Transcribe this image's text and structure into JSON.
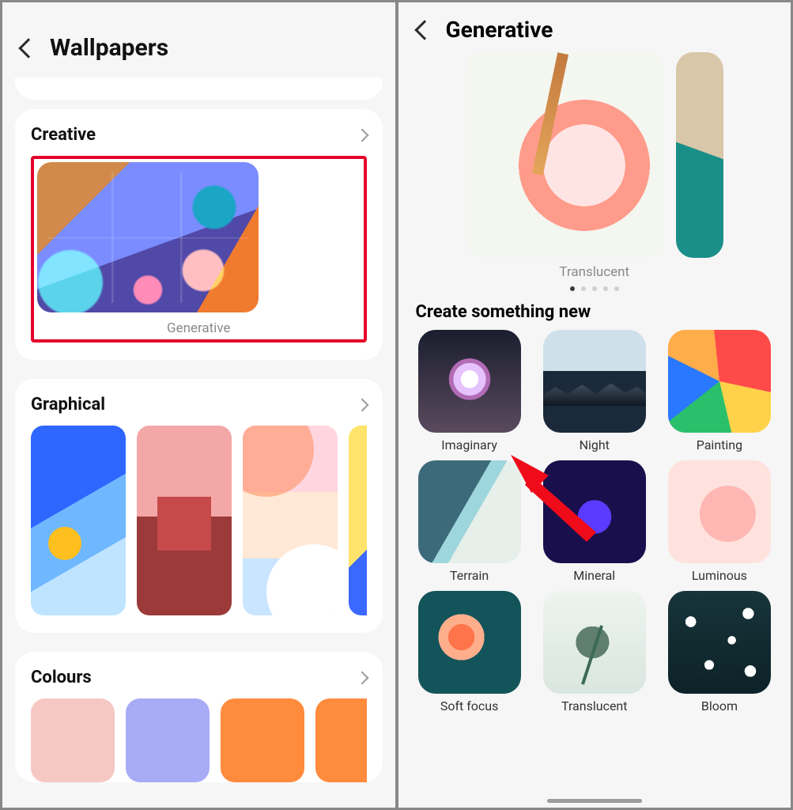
{
  "left": {
    "title": "Wallpapers",
    "creative": {
      "heading": "Creative",
      "generative_label": "Generative"
    },
    "graphical": {
      "heading": "Graphical"
    },
    "colours": {
      "heading": "Colours",
      "swatches": [
        "#f6c8c4",
        "#a8abf6",
        "#ff8b3d",
        "#ff8b3d"
      ]
    }
  },
  "right": {
    "title": "Generative",
    "hero_label": "Translucent",
    "page_dots": {
      "count": 5,
      "active": 0
    },
    "create_heading": "Create something new",
    "categories": [
      {
        "id": "imaginary",
        "label": "Imaginary"
      },
      {
        "id": "night",
        "label": "Night"
      },
      {
        "id": "painting",
        "label": "Painting"
      },
      {
        "id": "terrain",
        "label": "Terrain"
      },
      {
        "id": "mineral",
        "label": "Mineral"
      },
      {
        "id": "luminous",
        "label": "Luminous"
      },
      {
        "id": "softfocus",
        "label": "Soft focus"
      },
      {
        "id": "translucent",
        "label": "Translucent"
      },
      {
        "id": "bloom",
        "label": "Bloom"
      }
    ]
  }
}
